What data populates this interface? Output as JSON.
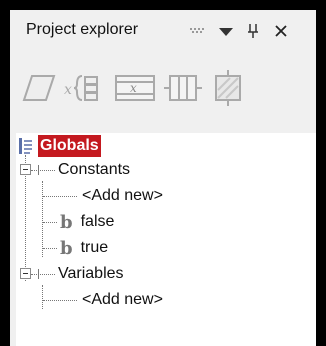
{
  "window": {
    "title": "Project explorer"
  },
  "tree": {
    "root": {
      "label": "Globals"
    },
    "groups": [
      {
        "label": "Constants",
        "children": [
          {
            "label": "<Add new>"
          },
          {
            "label": "false"
          },
          {
            "label": "true"
          }
        ]
      },
      {
        "label": "Variables",
        "children": [
          {
            "label": "<Add new>"
          }
        ]
      }
    ]
  },
  "icons": {
    "pin_glyph": "∥",
    "close_glyph": "✕",
    "bool_glyph": "b"
  }
}
